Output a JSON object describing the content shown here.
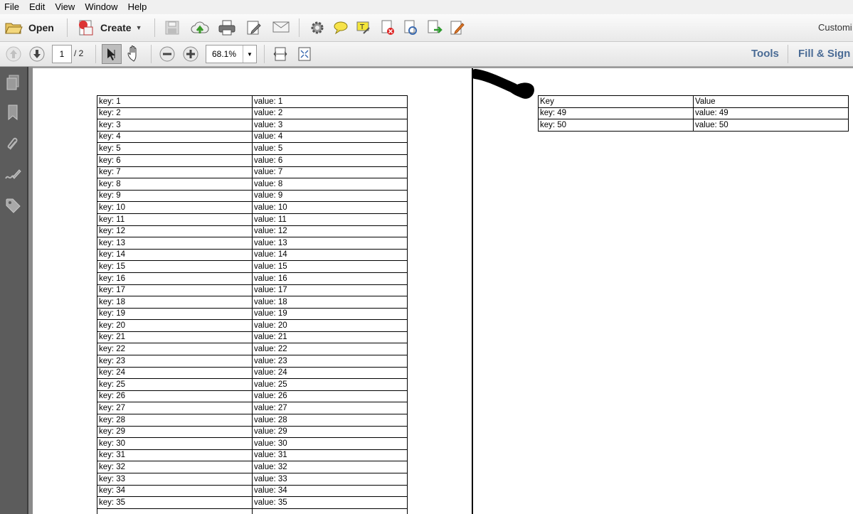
{
  "menu": [
    "File",
    "Edit",
    "View",
    "Window",
    "Help"
  ],
  "toolbar": {
    "open_label": "Open",
    "create_label": "Create",
    "customize_label": "Customi"
  },
  "nav": {
    "page_current": "1",
    "page_total": "/ 2",
    "zoom": "68.1%"
  },
  "panels": {
    "tools": "Tools",
    "fill_sign": "Fill & Sign"
  },
  "page1_rows": [
    [
      "key: 1",
      "value: 1"
    ],
    [
      "key: 2",
      "value: 2"
    ],
    [
      "key: 3",
      "value: 3"
    ],
    [
      "key: 4",
      "value: 4"
    ],
    [
      "key: 5",
      "value: 5"
    ],
    [
      "key: 6",
      "value: 6"
    ],
    [
      "key: 7",
      "value: 7"
    ],
    [
      "key: 8",
      "value: 8"
    ],
    [
      "key: 9",
      "value: 9"
    ],
    [
      "key: 10",
      "value: 10"
    ],
    [
      "key: 11",
      "value: 11"
    ],
    [
      "key: 12",
      "value: 12"
    ],
    [
      "key: 13",
      "value: 13"
    ],
    [
      "key: 14",
      "value: 14"
    ],
    [
      "key: 15",
      "value: 15"
    ],
    [
      "key: 16",
      "value: 16"
    ],
    [
      "key: 17",
      "value: 17"
    ],
    [
      "key: 18",
      "value: 18"
    ],
    [
      "key: 19",
      "value: 19"
    ],
    [
      "key: 20",
      "value: 20"
    ],
    [
      "key: 21",
      "value: 21"
    ],
    [
      "key: 22",
      "value: 22"
    ],
    [
      "key: 23",
      "value: 23"
    ],
    [
      "key: 24",
      "value: 24"
    ],
    [
      "key: 25",
      "value: 25"
    ],
    [
      "key: 26",
      "value: 26"
    ],
    [
      "key: 27",
      "value: 27"
    ],
    [
      "key: 28",
      "value: 28"
    ],
    [
      "key: 29",
      "value: 29"
    ],
    [
      "key: 30",
      "value: 30"
    ],
    [
      "key: 31",
      "value: 31"
    ],
    [
      "key: 32",
      "value: 32"
    ],
    [
      "key: 33",
      "value: 33"
    ],
    [
      "key: 34",
      "value: 34"
    ],
    [
      "key: 35",
      "value: 35"
    ],
    [
      "",
      ""
    ]
  ],
  "page2_header": [
    "Key",
    "Value"
  ],
  "page2_rows": [
    [
      "key: 49",
      "value: 49"
    ],
    [
      "key: 50",
      "value: 50"
    ]
  ],
  "icons": {
    "left_nav": [
      "pages-icon",
      "bookmark-icon",
      "paperclip-icon",
      "signature-icon",
      "tag-icon"
    ]
  }
}
